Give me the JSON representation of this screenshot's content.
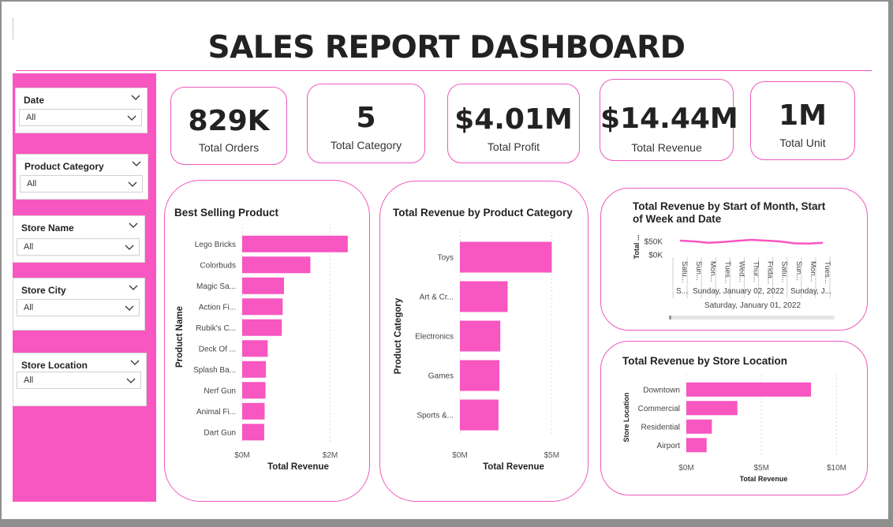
{
  "dashboard": {
    "title": "SALES REPORT DASHBOARD"
  },
  "filters": [
    {
      "label": "Date",
      "value": "All"
    },
    {
      "label": "Product Category",
      "value": "All"
    },
    {
      "label": "Store Name",
      "value": "All"
    },
    {
      "label": "Store City",
      "value": "All"
    },
    {
      "label": "Store Location",
      "value": "All"
    }
  ],
  "kpis": [
    {
      "value": "829K",
      "label": "Total Orders"
    },
    {
      "value": "5",
      "label": "Total Category"
    },
    {
      "value": "$4.01M",
      "label": "Total Profit"
    },
    {
      "value": "$14.44M",
      "label": "Total Revenue"
    },
    {
      "value": "1M",
      "label": "Total Unit"
    }
  ],
  "colors": {
    "accent": "#f856c0",
    "bar": "#f856c0",
    "border": "#ef58bd",
    "text": "#222222"
  },
  "chart_data": [
    {
      "type": "bar",
      "orientation": "horizontal",
      "title": "Best Selling Product",
      "xlabel": "Total Revenue",
      "ylabel": "Product Name",
      "categories": [
        "Lego Bricks",
        "Colorbuds",
        "Magic Sa...",
        "Action Fi...",
        "Rubik's C...",
        "Deck Of ...",
        "Splash Ba...",
        "Nerf Gun",
        "Animal Fi...",
        "Dart Gun"
      ],
      "values": [
        2.4,
        1.55,
        0.95,
        0.92,
        0.9,
        0.58,
        0.54,
        0.53,
        0.51,
        0.5
      ],
      "xticks": [
        0,
        2
      ],
      "xtick_labels": [
        "$0M",
        "$2M"
      ],
      "xlim": [
        0,
        2.6
      ]
    },
    {
      "type": "bar",
      "orientation": "horizontal",
      "title": "Total Revenue by Product Category",
      "xlabel": "Total Revenue",
      "ylabel": "Product Category",
      "categories": [
        "Toys",
        "Art & Cr...",
        "Electronics",
        "Games",
        "Sports &..."
      ],
      "values": [
        5.0,
        2.6,
        2.2,
        2.15,
        2.1
      ],
      "xticks": [
        0,
        5
      ],
      "xtick_labels": [
        "$0M",
        "$5M"
      ],
      "xlim": [
        0,
        5.5
      ]
    },
    {
      "type": "line",
      "title": "Total Revenue by Start of Month, Start of Week and Date",
      "ylabel": "Total ...",
      "yticks": [
        0,
        50
      ],
      "ytick_labels": [
        "$0K",
        "$50K"
      ],
      "ylim": [
        0,
        70
      ],
      "x": [
        "Satu...",
        "Sun...",
        "Mon...",
        "Tues...",
        "Wed...",
        "Thur...",
        "Frida...",
        "Satu...",
        "Sun...",
        "Mon...",
        "Tues..."
      ],
      "values": [
        53,
        50,
        45,
        48,
        52,
        56,
        53,
        50,
        43,
        42,
        45
      ],
      "week_labels": [
        "S...",
        "Sunday, January 02, 2022",
        "Sunday, J..."
      ],
      "month_labels": [
        "Saturday, January 01, 2022"
      ]
    },
    {
      "type": "bar",
      "orientation": "horizontal",
      "title": "Total Revenue by Store Location",
      "xlabel": "Total Revenue",
      "ylabel": "Store Location",
      "categories": [
        "Downtown",
        "Commercial",
        "Residential",
        "Airport"
      ],
      "values": [
        8.3,
        3.4,
        1.7,
        1.35
      ],
      "xticks": [
        0,
        5,
        10
      ],
      "xtick_labels": [
        "$0M",
        "$5M",
        "$10M"
      ],
      "xlim": [
        0,
        10.5
      ]
    }
  ]
}
